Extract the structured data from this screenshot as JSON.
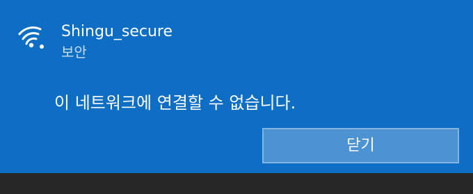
{
  "network": {
    "icon": "wifi-secured-icon",
    "name": "Shingu_secure",
    "security": "보안"
  },
  "message": "이 네트워크에 연결할 수 없습니다.",
  "buttons": {
    "close_label": "닫기"
  },
  "colors": {
    "panel_background": "#0e6ec4",
    "button_background": "#4d93d2",
    "button_border": "#7fb4e3",
    "secondary_text": "#c7def3"
  }
}
